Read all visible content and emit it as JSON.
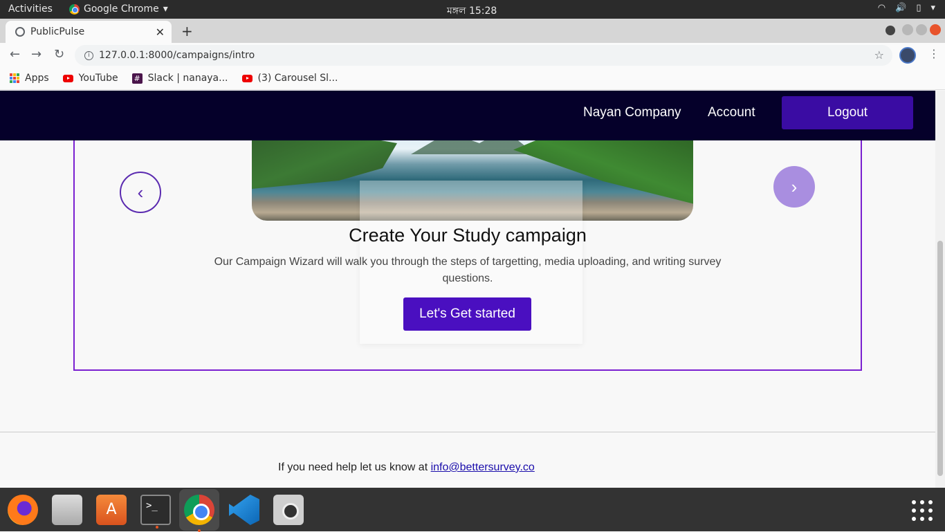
{
  "system_bar": {
    "activities": "Activities",
    "app_name": "Google Chrome",
    "clock": "মঙ্গল 15:28"
  },
  "browser": {
    "tab_title": "PublicPulse",
    "url": "127.0.0.1:8000/campaigns/intro",
    "bookmarks": [
      "Apps",
      "YouTube",
      "Slack | nanaya...",
      "(3) Carousel Sl..."
    ]
  },
  "site_nav": {
    "company": "Nayan Company",
    "account": "Account",
    "logout": "Logout"
  },
  "carousel": {
    "title": "Create Your Study campaign",
    "description": "Our Campaign Wizard will walk you through the steps of targetting, media uploading, and writing survey questions.",
    "cta": "Let's Get started",
    "prev_icon": "chevron-left-icon",
    "next_icon": "chevron-right-icon"
  },
  "footer": {
    "help_text": "If you need help let us know at",
    "email": "info@bettersurvey.co"
  },
  "colors": {
    "nav_bg": "#05002a",
    "primary": "#4a0fc0",
    "border": "#7a1fd0"
  }
}
